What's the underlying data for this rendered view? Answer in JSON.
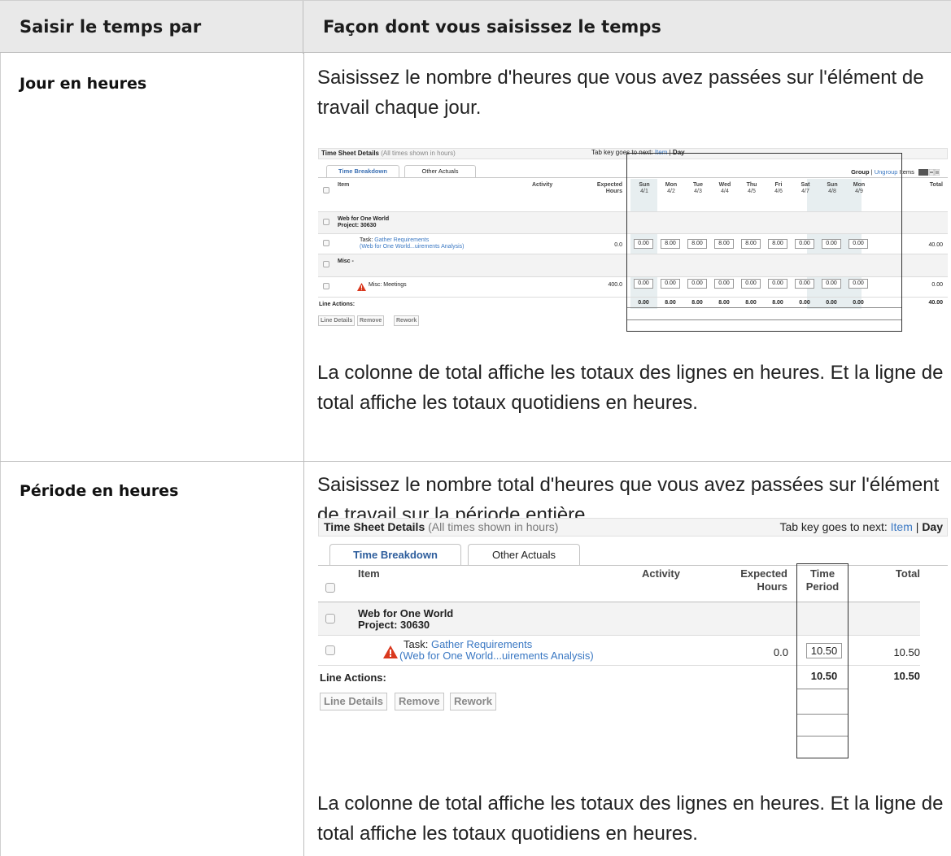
{
  "table": {
    "col1_header": "Saisir le temps par",
    "col2_header": "Façon dont vous saisissez le temps"
  },
  "rows": [
    {
      "title": "Jour en heures",
      "intro": "Saisissez le nombre d'heures que vous avez passées sur l'élément de travail chaque jour.",
      "outro": "La colonne de total affiche les totaux des lignes en heures. Et la ligne de total affiche les totaux quotidiens en heures."
    },
    {
      "title": "Période en heures",
      "intro": "Saisissez le nombre total d'heures que vous avez passées sur l'élément de travail sur la période entière.",
      "outro": "La colonne de total affiche les totaux des lignes en heures. Et la ligne de total affiche les totaux quotidiens en heures."
    }
  ],
  "ts1": {
    "title": "Time Sheet Details",
    "subtitle": "(All times shown in hours)",
    "tabkey_prefix": "Tab key goes to next: ",
    "tabkey_item": "Item",
    "tabkey_sep": " | ",
    "tabkey_day": "Day",
    "tab_breakdown": "Time Breakdown",
    "tab_actuals": "Other Actuals",
    "group": "Group",
    "group_sep": " | ",
    "ungroup": "Ungroup",
    "items": " Items",
    "col_item": "Item",
    "col_activity": "Activity",
    "col_expected_1": "Expected",
    "col_expected_2": "Hours",
    "col_total": "Total",
    "days": [
      {
        "d": "Sun",
        "date": "4/1"
      },
      {
        "d": "Mon",
        "date": "4/2"
      },
      {
        "d": "Tue",
        "date": "4/3"
      },
      {
        "d": "Wed",
        "date": "4/4"
      },
      {
        "d": "Thu",
        "date": "4/5"
      },
      {
        "d": "Fri",
        "date": "4/6"
      },
      {
        "d": "Sat",
        "date": "4/7"
      },
      {
        "d": "Sun",
        "date": "4/8"
      },
      {
        "d": "Mon",
        "date": "4/9"
      }
    ],
    "group1_name": "Web for One World",
    "group1_project": "Project: 30630",
    "task_prefix": "Task: ",
    "task_link": "Gather Requirements",
    "task_sub": "(Web for One World...uirements Analysis)",
    "task_expected": "0.0",
    "task_values": [
      "0.00",
      "8.00",
      "8.00",
      "8.00",
      "8.00",
      "8.00",
      "0.00",
      "0.00",
      "0.00"
    ],
    "task_total": "40.00",
    "group2_name": "Misc -",
    "misc_label": "Misc: Meetings",
    "misc_expected": "400.0",
    "misc_values": [
      "0.00",
      "0.00",
      "0.00",
      "0.00",
      "0.00",
      "0.00",
      "0.00",
      "0.00",
      "0.00"
    ],
    "misc_total": "0.00",
    "line_actions": "Line Actions:",
    "totals": [
      "0.00",
      "8.00",
      "8.00",
      "8.00",
      "8.00",
      "8.00",
      "0.00",
      "0.00",
      "0.00"
    ],
    "grand_total": "40.00",
    "btn_details": "Line Details",
    "btn_remove": "Remove",
    "btn_rework": "Rework"
  },
  "ts2": {
    "title": "Time Sheet Details",
    "subtitle": "(All times shown in hours)",
    "tabkey_prefix": "Tab key goes to next: ",
    "tabkey_item": "Item",
    "tabkey_sep": " | ",
    "tabkey_day": "Day",
    "tab_breakdown": "Time Breakdown",
    "tab_actuals": "Other Actuals",
    "col_item": "Item",
    "col_activity": "Activity",
    "col_expected_1": "Expected",
    "col_expected_2": "Hours",
    "col_period_1": "Time",
    "col_period_2": "Period",
    "col_total": "Total",
    "group1_name": "Web for One World",
    "group1_project": "Project: 30630",
    "task_prefix": "Task: ",
    "task_link": "Gather Requirements",
    "task_sub": "(Web for One World...uirements Analysis)",
    "task_expected": "0.0",
    "task_value": "10.50",
    "task_total": "10.50",
    "line_actions": "Line Actions:",
    "period_total": "10.50",
    "grand_total": "10.50",
    "btn_details": "Line Details",
    "btn_remove": "Remove",
    "btn_rework": "Rework"
  },
  "colors": {
    "header_bg": "#e9e9e9",
    "link": "#3a78c3",
    "warning": "#d9381e"
  }
}
